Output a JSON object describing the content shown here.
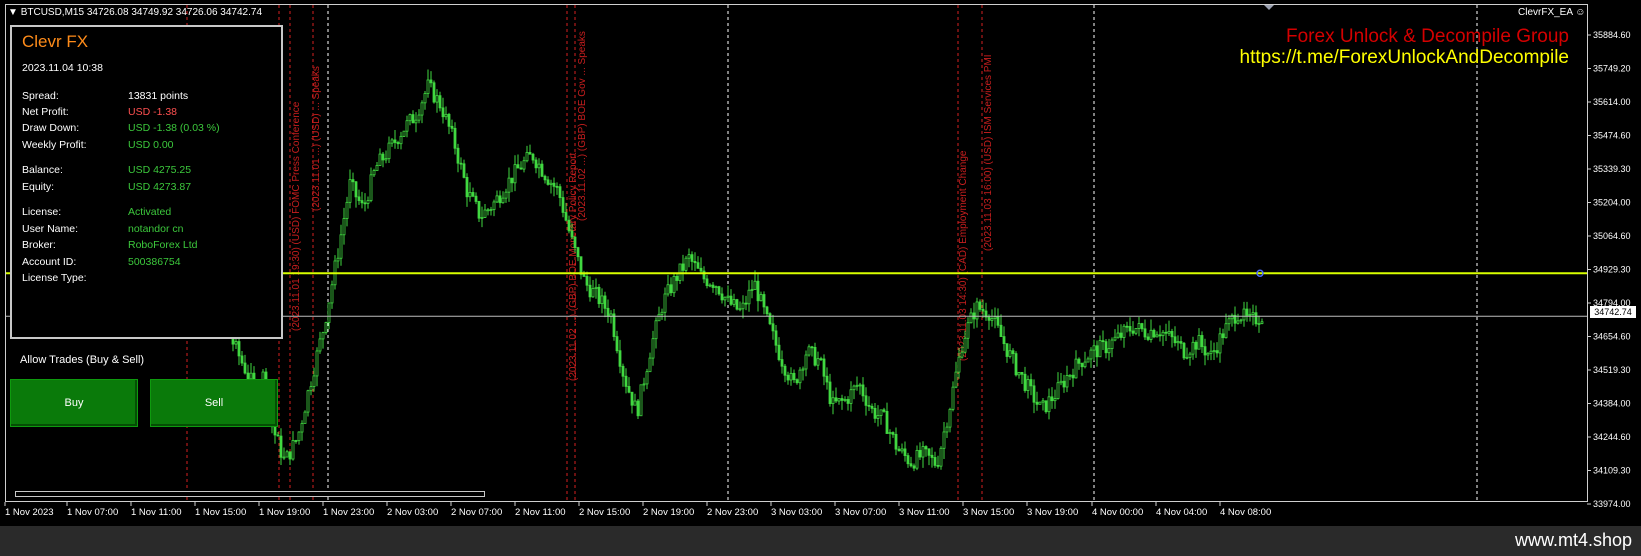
{
  "header": {
    "symbol": "BTCUSD,M15",
    "ohlc": "34726.08 34749.92 34726.06 34742.74",
    "ea_name": "ClevrFX_EA"
  },
  "promo": {
    "title": "Forex Unlock & Decompile Group",
    "url": "https://t.me/ForexUnlockAndDecompile"
  },
  "panel": {
    "title": "Clevr FX",
    "datetime": "2023.11.04 10:38",
    "rows": [
      {
        "label": "Spread:",
        "value": "13831 points",
        "color": "#ffffff"
      },
      {
        "label": "Net Profit:",
        "value": "USD -1.38",
        "color": "#ff5050"
      },
      {
        "label": "Draw Down:",
        "value": "USD -1.38 (0.03 %)",
        "color": "#3cc83c"
      },
      {
        "label": "Weekly Profit:",
        "value": "USD 0.00",
        "color": "#3cc83c"
      },
      {
        "label": "Balance:",
        "value": "USD 4275.25",
        "color": "#3cc83c"
      },
      {
        "label": "Equity:",
        "value": "USD 4273.87",
        "color": "#3cc83c"
      },
      {
        "label": "License:",
        "value": "Activated",
        "color": "#3cc83c"
      },
      {
        "label": "User Name:",
        "value": "notandor cn",
        "color": "#3cc83c"
      },
      {
        "label": "Broker:",
        "value": "RoboForex Ltd",
        "color": "#3cc83c"
      },
      {
        "label": "Account ID:",
        "value": "500386754",
        "color": "#3cc83c"
      },
      {
        "label": "License Type:",
        "value": "",
        "color": "#3cc83c"
      }
    ]
  },
  "trade": {
    "allow_label": "Allow Trades (Buy & Sell)",
    "buy_label": "Buy",
    "sell_label": "Sell"
  },
  "current_price": "34742.74",
  "footer": {
    "brand": "www.mt4.shop"
  },
  "colors": {
    "candle": "#40d840",
    "level_line": "#d8ff00",
    "news_line": "#d42020",
    "day_line": "#ffffff"
  },
  "chart_data": {
    "type": "candlestick",
    "y_ticks": [
      "35884.60",
      "35749.20",
      "35614.00",
      "35474.60",
      "35339.30",
      "35204.00",
      "35064.60",
      "34929.30",
      "34794.00",
      "34654.60",
      "34519.30",
      "34384.00",
      "34244.60",
      "34109.30",
      "33974.00"
    ],
    "x_ticks": [
      "1 Nov 2023",
      "1 Nov 07:00",
      "1 Nov 11:00",
      "1 Nov 15:00",
      "1 Nov 19:00",
      "1 Nov 23:00",
      "2 Nov 03:00",
      "2 Nov 07:00",
      "2 Nov 11:00",
      "2 Nov 15:00",
      "2 Nov 19:00",
      "2 Nov 23:00",
      "3 Nov 03:00",
      "3 Nov 07:00",
      "3 Nov 11:00",
      "3 Nov 15:00",
      "3 Nov 19:00",
      "4 Nov 00:00",
      "4 Nov 04:00",
      "4 Nov 08:00"
    ],
    "ylim": [
      33974,
      35884.6
    ],
    "level_price": 34918,
    "last_price": 34742.74,
    "news_events": [
      "(2023.11.01 19:30) (USD) FOMC Press Conference",
      "(2023.11.01 ...) (USD) ... Speaks",
      "(2023.11.02 ...) (GBP) BOE Monetary Policy Report",
      "(2023.11.02 ...) (GBP) BOE Gov ... Speaks",
      "(2023.11.03 14:30) (CAD) Employment Change",
      "(2023.11.03 16:00) (USD) ISM Services PMI"
    ],
    "close_path": [
      [
        0,
        34880
      ],
      [
        6,
        34830
      ],
      [
        10,
        34760
      ],
      [
        14,
        34600
      ],
      [
        18,
        34450
      ],
      [
        20,
        34500
      ],
      [
        22,
        34300
      ],
      [
        25,
        34150
      ],
      [
        28,
        34250
      ],
      [
        31,
        34480
      ],
      [
        34,
        34700
      ],
      [
        37,
        34980
      ],
      [
        40,
        35280
      ],
      [
        43,
        35180
      ],
      [
        46,
        35350
      ],
      [
        49,
        35420
      ],
      [
        52,
        35500
      ],
      [
        55,
        35560
      ],
      [
        58,
        35680
      ],
      [
        61,
        35600
      ],
      [
        64,
        35450
      ],
      [
        67,
        35250
      ],
      [
        70,
        35150
      ],
      [
        73,
        35200
      ],
      [
        76,
        35280
      ],
      [
        79,
        35350
      ],
      [
        82,
        35400
      ],
      [
        85,
        35320
      ],
      [
        88,
        35250
      ],
      [
        91,
        35050
      ],
      [
        94,
        34880
      ],
      [
        97,
        34820
      ],
      [
        100,
        34750
      ],
      [
        103,
        34500
      ],
      [
        106,
        34350
      ],
      [
        109,
        34600
      ],
      [
        112,
        34800
      ],
      [
        115,
        34900
      ],
      [
        118,
        34980
      ],
      [
        121,
        34900
      ],
      [
        124,
        34880
      ],
      [
        127,
        34800
      ],
      [
        130,
        34760
      ],
      [
        133,
        34880
      ],
      [
        136,
        34720
      ],
      [
        139,
        34580
      ],
      [
        142,
        34460
      ],
      [
        145,
        34600
      ],
      [
        148,
        34560
      ],
      [
        151,
        34380
      ],
      [
        154,
        34400
      ],
      [
        157,
        34470
      ],
      [
        160,
        34360
      ],
      [
        163,
        34320
      ],
      [
        166,
        34200
      ],
      [
        169,
        34150
      ],
      [
        172,
        34180
      ],
      [
        175,
        34140
      ],
      [
        178,
        34380
      ],
      [
        181,
        34650
      ],
      [
        184,
        34780
      ],
      [
        187,
        34760
      ],
      [
        190,
        34650
      ],
      [
        193,
        34540
      ],
      [
        196,
        34450
      ],
      [
        199,
        34360
      ],
      [
        202,
        34420
      ],
      [
        205,
        34500
      ],
      [
        208,
        34560
      ],
      [
        211,
        34600
      ],
      [
        214,
        34620
      ],
      [
        217,
        34660
      ],
      [
        220,
        34700
      ],
      [
        223,
        34680
      ],
      [
        226,
        34690
      ],
      [
        229,
        34650
      ],
      [
        232,
        34600
      ],
      [
        235,
        34640
      ],
      [
        238,
        34580
      ],
      [
        241,
        34680
      ],
      [
        244,
        34760
      ],
      [
        247,
        34720
      ],
      [
        250,
        34750
      ]
    ]
  }
}
